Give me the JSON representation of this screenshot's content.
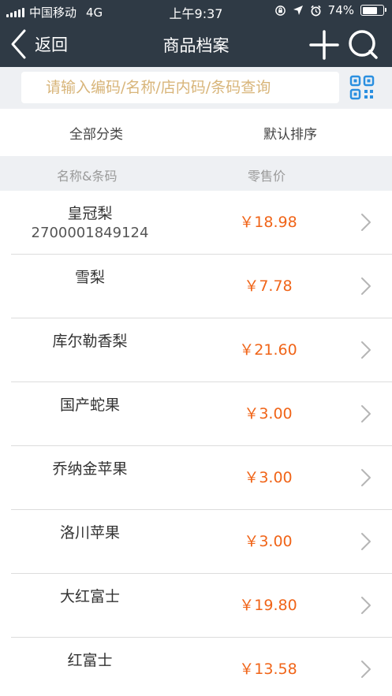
{
  "status_bar": {
    "carrier": "中国移动",
    "network": "4G",
    "time": "上午9:37",
    "battery": "74%",
    "battery_level": 0.74
  },
  "nav": {
    "back_label": "返回",
    "title": "商品档案"
  },
  "search": {
    "placeholder": "请输入编码/名称/店内码/条码查询"
  },
  "filters": {
    "category": "全部分类",
    "sort": "默认排序"
  },
  "columns": {
    "name": "名称&条码",
    "price": "零售价"
  },
  "products": [
    {
      "name": "皇冠梨",
      "barcode": "2700001849124",
      "price": "￥18.98"
    },
    {
      "name": "雪梨",
      "barcode": "",
      "price": "￥7.78"
    },
    {
      "name": "库尔勒香梨",
      "barcode": "",
      "price": "￥21.60"
    },
    {
      "name": "国产蛇果",
      "barcode": "",
      "price": "￥3.00"
    },
    {
      "name": "乔纳金苹果",
      "barcode": "",
      "price": "￥3.00"
    },
    {
      "name": "洛川苹果",
      "barcode": "",
      "price": "￥3.00"
    },
    {
      "name": "大红富士",
      "barcode": "",
      "price": "￥19.80"
    },
    {
      "name": "红富士",
      "barcode": "",
      "price": "￥13.58"
    }
  ],
  "colors": {
    "header_bg": "#2f3a45",
    "price": "#f06418",
    "qr_icon": "#2a8fe0",
    "placeholder": "#d8b57a"
  },
  "icons": {
    "back": "chevron-left-icon",
    "add": "plus-icon",
    "search": "search-icon",
    "qr": "qr-code-icon",
    "row_chevron": "chevron-right-icon"
  }
}
